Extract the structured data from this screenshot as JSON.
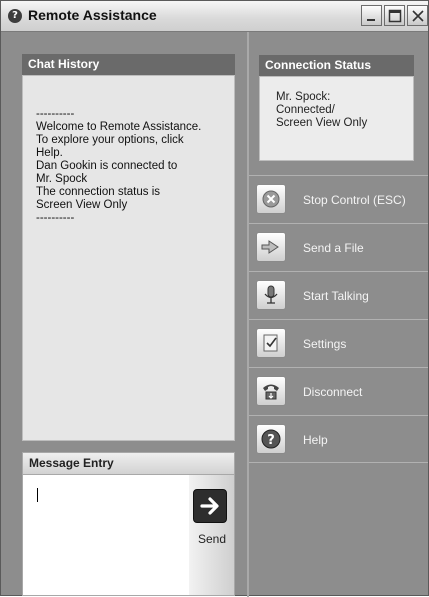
{
  "window": {
    "title": "Remote Assistance"
  },
  "chat_history": {
    "header": "Chat History",
    "lines": [
      "----------",
      "Welcome to Remote Assistance.",
      "To explore your options, click",
      "Help.",
      "Dan Gookin is connected to",
      "Mr. Spock",
      "The connection status is",
      "Screen View Only",
      "----------"
    ]
  },
  "message_entry": {
    "header": "Message Entry",
    "value": "",
    "send_label": "Send"
  },
  "connection_status": {
    "header": "Connection Status",
    "lines": [
      "Mr. Spock:",
      "Connected/",
      "Screen View Only"
    ]
  },
  "actions": [
    {
      "label": "Stop Control (ESC)",
      "icon": "stop-icon"
    },
    {
      "label": "Send a File",
      "icon": "send-file-icon"
    },
    {
      "label": "Start Talking",
      "icon": "microphone-icon"
    },
    {
      "label": "Settings",
      "icon": "settings-icon"
    },
    {
      "label": "Disconnect",
      "icon": "disconnect-icon"
    },
    {
      "label": "Help",
      "icon": "help-icon"
    }
  ]
}
